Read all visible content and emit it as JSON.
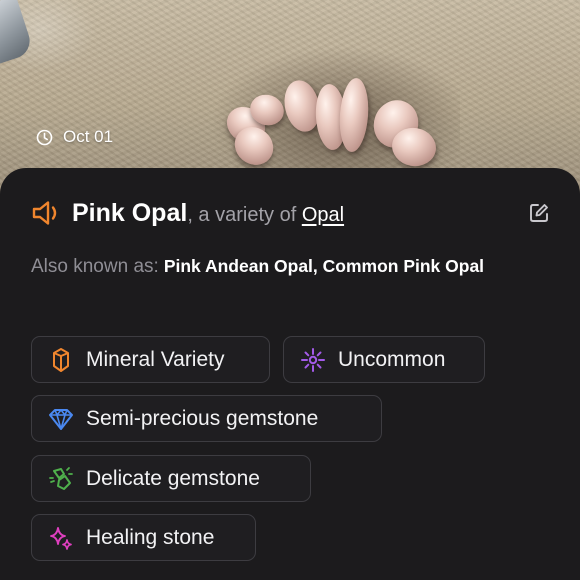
{
  "photo": {
    "date": "Oct 01"
  },
  "header": {
    "name": "Pink Opal",
    "connector": ", a variety of ",
    "parent_link": "Opal",
    "speaker_icon": "speaker-icon",
    "edit_icon": "edit-icon"
  },
  "aka": {
    "label": "Also known as:",
    "values": "Pink Andean Opal, Common Pink Opal"
  },
  "chips": [
    {
      "label": "Mineral Variety",
      "icon": "crystal-icon",
      "color": "#f0862e"
    },
    {
      "label": "Uncommon",
      "icon": "sparkle-burst-icon",
      "color": "#a35ae8"
    },
    {
      "label": "Semi-precious gemstone",
      "icon": "diamond-icon",
      "color": "#4a88f0"
    },
    {
      "label": "Delicate gemstone",
      "icon": "broken-gem-icon",
      "color": "#4fb04c"
    },
    {
      "label": "Healing stone",
      "icon": "sparkles-icon",
      "color": "#e03fc0"
    }
  ],
  "colors": {
    "accent_orange": "#f0862e",
    "sheet_background": "#1c1b1d",
    "secondary_text": "#8f8e95"
  }
}
